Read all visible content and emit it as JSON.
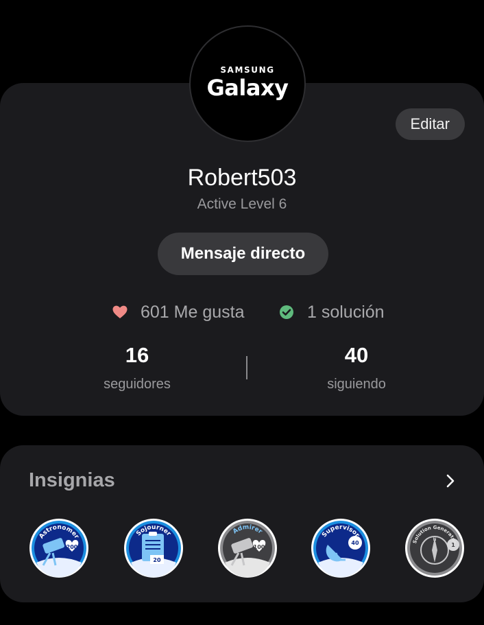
{
  "profile": {
    "avatar": {
      "brand_top": "SAMSUNG",
      "brand_main": "Galaxy"
    },
    "edit_label": "Editar",
    "username": "Robert503",
    "level": "Active Level 6",
    "direct_message_label": "Mensaje directo",
    "likes": {
      "text": "601 Me gusta",
      "icon": "heart-icon"
    },
    "solutions": {
      "text": "1 solución",
      "icon": "check-circle-icon"
    },
    "followers": {
      "count": "16",
      "label": "seguidores"
    },
    "following": {
      "count": "40",
      "label": "siguiendo"
    }
  },
  "badges": {
    "title": "Insignias",
    "more_icon": "chevron-right-icon",
    "items": [
      {
        "name": "Astronomer",
        "value": "200",
        "ring": "#1c8fe0"
      },
      {
        "name": "Sojourner",
        "value": "20",
        "ring": "#1c8fe0"
      },
      {
        "name": "Admirer",
        "value": "100",
        "ring": "#8c8c8f"
      },
      {
        "name": "Supervisor",
        "value": "40",
        "ring": "#1c8fe0"
      },
      {
        "name": "Solution Generator",
        "value": "1",
        "ring": "#8c8c8f"
      }
    ]
  },
  "colors": {
    "background": "#000000",
    "card": "#1b1b1e",
    "button": "#39393c",
    "heart": "#f08a86",
    "check": "#5fba7d",
    "badge_blue": "#1c8fe0"
  }
}
